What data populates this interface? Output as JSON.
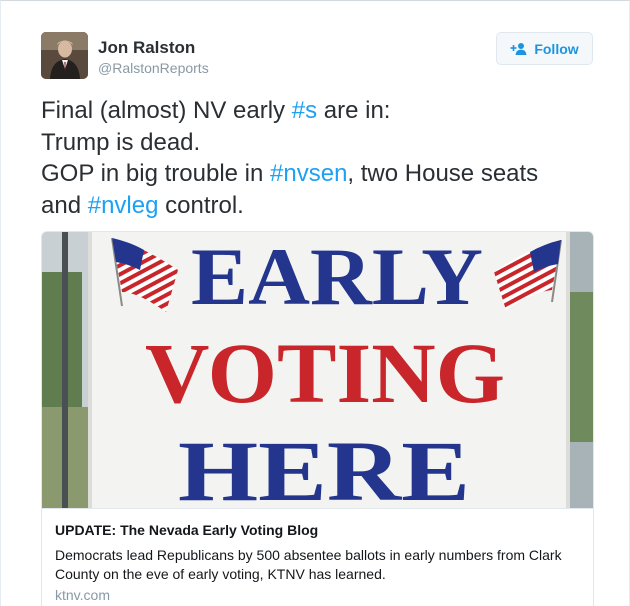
{
  "author": {
    "name": "Jon Ralston",
    "handle": "@RalstonReports"
  },
  "follow_button": {
    "label": "Follow",
    "icon": "follow-person-plus-icon"
  },
  "tweet": {
    "line1_prefix": "Final (almost) NV early ",
    "line1_hashtag": "#s",
    "line1_suffix": " are in:",
    "line2": "Trump is dead.",
    "line3_prefix": "GOP in big trouble in ",
    "line3_hashtag": "#nvsen",
    "line3_suffix": ", two House seats",
    "line4_prefix": "and ",
    "line4_hashtag": "#nvleg",
    "line4_suffix": " control."
  },
  "card": {
    "image": {
      "line1": "EARLY",
      "line2": "VOTING",
      "line3": "HERE"
    },
    "title": "UPDATE: The Nevada Early Voting Blog",
    "description": "Democrats lead Republicans by 500 absentee ballots in early numbers from Clark County on the eve of early voting, KTNV has learned.",
    "domain": "ktnv.com"
  },
  "colors": {
    "hashtag": "#1da1f2",
    "follow_text": "#1b95e0",
    "sign_blue": "#23358d",
    "sign_red": "#c8262b",
    "handle_gray": "#8899a6"
  }
}
